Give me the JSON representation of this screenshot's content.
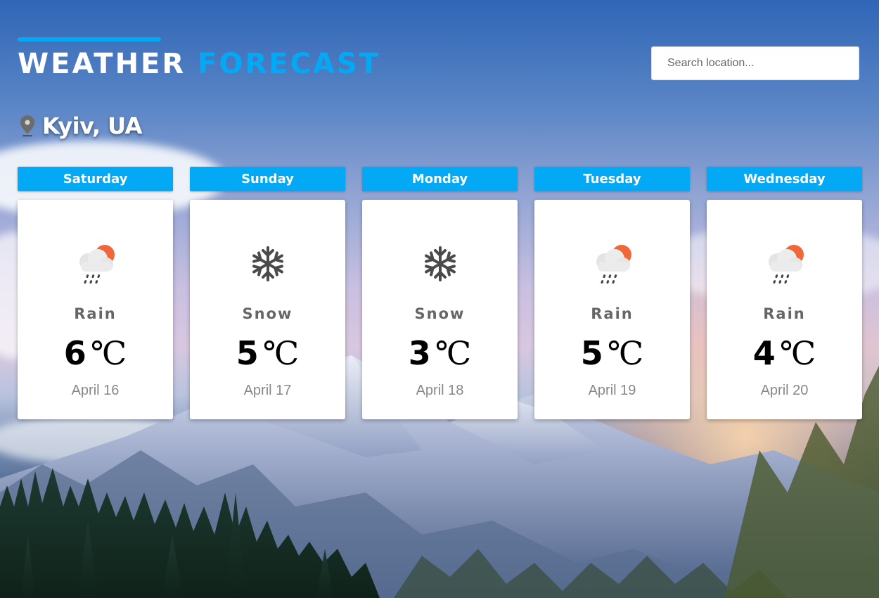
{
  "header": {
    "title_part1": "WEATHER",
    "title_part2": "FORECAST",
    "accent_color": "#03a9f4"
  },
  "search": {
    "placeholder": "Search location...",
    "value": ""
  },
  "location": {
    "icon": "map-pin-icon",
    "name": "Kyiv, UA"
  },
  "forecast": [
    {
      "day": "Saturday",
      "condition": "Rain",
      "temp": "6",
      "unit": "℃",
      "date": "April 16",
      "icon": "rain-cloud-sun-icon"
    },
    {
      "day": "Sunday",
      "condition": "Snow",
      "temp": "5",
      "unit": "℃",
      "date": "April 17",
      "icon": "snowflake-icon"
    },
    {
      "day": "Monday",
      "condition": "Snow",
      "temp": "3",
      "unit": "℃",
      "date": "April 18",
      "icon": "snowflake-icon"
    },
    {
      "day": "Tuesday",
      "condition": "Rain",
      "temp": "5",
      "unit": "℃",
      "date": "April 19",
      "icon": "rain-cloud-sun-icon"
    },
    {
      "day": "Wednesday",
      "condition": "Rain",
      "temp": "4",
      "unit": "℃",
      "date": "April 20",
      "icon": "rain-cloud-sun-icon"
    }
  ]
}
